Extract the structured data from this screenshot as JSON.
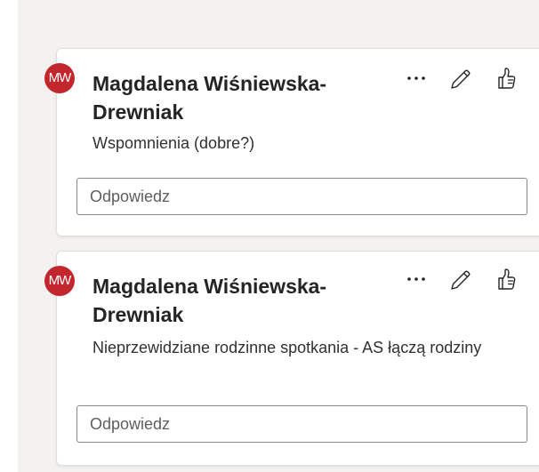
{
  "comments": [
    {
      "avatar_initials": "MW",
      "author": "Magdalena Wiśniewska-Drewniak",
      "text": "Wspomnienia (dobre?)",
      "reply_placeholder": "Odpowiedz",
      "actions": {
        "more": "more-options-icon",
        "edit": "pencil-icon",
        "like": "thumbs-up-icon"
      }
    },
    {
      "avatar_initials": "MW",
      "author": "Magdalena Wiśniewska-Drewniak",
      "text": "Nieprzewidziane rodzinne spotkania - AS łączą rodziny",
      "reply_placeholder": "Odpowiedz",
      "actions": {
        "more": "more-options-icon",
        "edit": "pencil-icon",
        "like": "thumbs-up-icon"
      }
    }
  ],
  "colors": {
    "avatar_bg": "#c4262e",
    "pane_bg": "#f3f2f1",
    "text": "#252423",
    "border": "#8a8886"
  }
}
